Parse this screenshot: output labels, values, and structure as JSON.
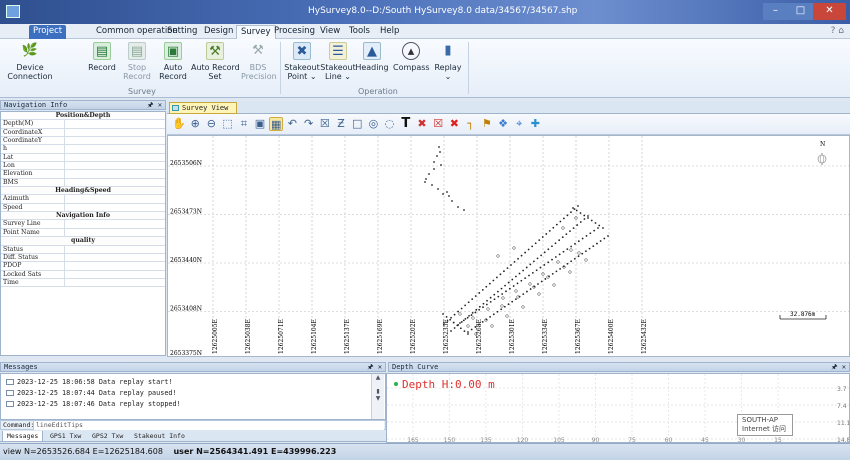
{
  "title": "HySurvey8.0--D:/South HySurvey8.0 data/34567/34567.shp",
  "window_controls": {
    "minimize": "–",
    "maximize": "□",
    "close": "✕"
  },
  "menu": {
    "tabs": [
      "Project",
      "Common operation",
      "Setting",
      "Design",
      "Survey",
      "Procesing",
      "View",
      "Tools",
      "Help"
    ],
    "active": "Survey"
  },
  "ribbon": {
    "buttons": [
      {
        "label": "Device\nConnection",
        "icon": "device-connection-icon",
        "enabled": true
      },
      {
        "label": "Record",
        "icon": "record-icon",
        "enabled": true
      },
      {
        "label": "Stop\nRecord",
        "icon": "stop-record-icon",
        "enabled": false
      },
      {
        "label": "Auto\nRecord",
        "icon": "auto-record-icon",
        "enabled": true
      },
      {
        "label": "Auto Record\nSet",
        "icon": "auto-record-set-icon",
        "enabled": true
      },
      {
        "label": "BDS\nPrecision",
        "icon": "bds-precision-icon",
        "enabled": false
      },
      {
        "label": "Stakeout\nPoint ⌄",
        "icon": "stakeout-point-icon",
        "enabled": true
      },
      {
        "label": "Stakeout\nLine ⌄",
        "icon": "stakeout-line-icon",
        "enabled": true
      },
      {
        "label": "Heading",
        "icon": "heading-icon",
        "enabled": true
      },
      {
        "label": "Compass",
        "icon": "compass-icon",
        "enabled": true
      },
      {
        "label": "Replay\n⌄",
        "icon": "replay-icon",
        "enabled": true
      }
    ],
    "groups": [
      "Survey",
      "Operation"
    ]
  },
  "nav_panel": {
    "title": "Navigation Info",
    "pin": "&#x1F4CC;",
    "rows": [
      {
        "type": "header",
        "label": "Position&Depth"
      },
      {
        "label": "Depth(M)"
      },
      {
        "label": "CoordinateX"
      },
      {
        "label": "CoordinateY"
      },
      {
        "label": "h"
      },
      {
        "label": "Lat"
      },
      {
        "label": "Lon"
      },
      {
        "label": "Elevation"
      },
      {
        "label": "BMS"
      },
      {
        "type": "header",
        "label": "Heading&Speed"
      },
      {
        "label": "Azimuth"
      },
      {
        "label": "Speed"
      },
      {
        "type": "header",
        "label": "Navigation Info"
      },
      {
        "label": "Survey Line"
      },
      {
        "label": "Point Name"
      },
      {
        "type": "header",
        "label": "quality"
      },
      {
        "label": "Status"
      },
      {
        "label": "Diff. Status"
      },
      {
        "label": "PDOP"
      },
      {
        "label": "Locked Sats"
      },
      {
        "label": "Time"
      }
    ]
  },
  "survey_view": {
    "tab": "Survey View",
    "tools": [
      "pan-icon",
      "zoom-in-icon",
      "zoom-out-icon",
      "zoom-window-icon",
      "zoom-extent-icon",
      "full-view-icon",
      "grid-icon",
      "undo-icon",
      "redo-icon",
      "x-mark-icon",
      "z-mark-icon",
      "rect-icon",
      "circle-icon",
      "clear-icon",
      "text-icon",
      "delete-point-icon",
      "delete-selected-icon",
      "close-red-icon",
      "ruler-icon",
      "measure-icon",
      "layer-icon",
      "center-icon",
      "move-icon"
    ],
    "y_labels": [
      "2653506N",
      "2653473N",
      "2653440N",
      "2653408N",
      "2653375N"
    ],
    "x_labels": [
      "12625005E",
      "12625038E",
      "12625071E",
      "12625104E",
      "12625137E",
      "12625169E",
      "12625202E",
      "12625235E",
      "12625268E",
      "12625301E",
      "12625334E",
      "12625367E",
      "12625400E",
      "12625432E"
    ],
    "scale": "32.876m",
    "north": "N"
  },
  "messages": {
    "title": "Messages",
    "lines": [
      "2023-12-25 18:06:58  Data replay start!",
      "2023-12-25 18:07:44  Data replay paused!",
      "2023-12-25 18:07:46  Data replay stopped!"
    ],
    "command_label": "Command:",
    "command_placeholder": "lineEditTips",
    "tabs": [
      "Messages",
      "GPS1 Txw",
      "GPS2 Txw",
      "Stakeout Info"
    ]
  },
  "depth": {
    "title": "Depth Curve",
    "reading": "Depth H:0.00 m",
    "y_ticks": [
      "3.7",
      "7.4",
      "11.1",
      "14.8"
    ],
    "x_ticks": [
      "165",
      "150",
      "135",
      "120",
      "105",
      "90",
      "75",
      "60",
      "45",
      "30",
      "15"
    ]
  },
  "tooltip": {
    "line1": "SOUTH-AP",
    "line2": "Internet 访问"
  },
  "status": {
    "view": "view N=2653526.684 E=12625184.608",
    "user": "user N=2564341.491 E=439996.223"
  },
  "colors": {
    "accent": "#3d6fc1",
    "depth_text": "#e03030",
    "track": "#222222"
  }
}
